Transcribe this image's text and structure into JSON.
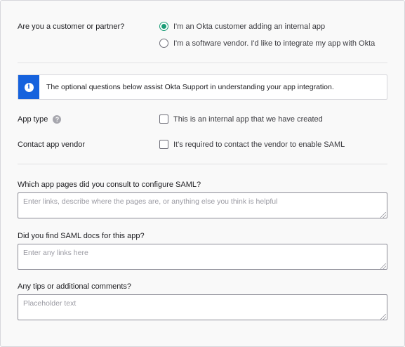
{
  "customer_question": {
    "label": "Are you a customer or partner?",
    "options": [
      {
        "label": "I'm an Okta customer adding an internal app",
        "selected": true
      },
      {
        "label": "I'm a software vendor. I'd like to integrate my app with Okta",
        "selected": false
      }
    ]
  },
  "info_banner": {
    "icon": "info-icon",
    "icon_glyph": "i",
    "text": "The optional questions below assist Okta Support in understanding your app integration."
  },
  "app_type": {
    "label": "App type",
    "help_glyph": "?",
    "option": "This is an internal app that we have created",
    "checked": false
  },
  "contact_vendor": {
    "label": "Contact app vendor",
    "option": "It's required to contact the vendor to enable SAML",
    "checked": false
  },
  "questions": [
    {
      "label": "Which app pages did you consult to configure SAML?",
      "placeholder": "Enter links, describe where the pages are, or anything else you think is helpful"
    },
    {
      "label": "Did you find SAML docs for this app?",
      "placeholder": "Enter any links here"
    },
    {
      "label": "Any tips or additional comments?",
      "placeholder": "Placeholder text"
    }
  ],
  "colors": {
    "accent": "#1a9c76",
    "info": "#1662dd"
  }
}
